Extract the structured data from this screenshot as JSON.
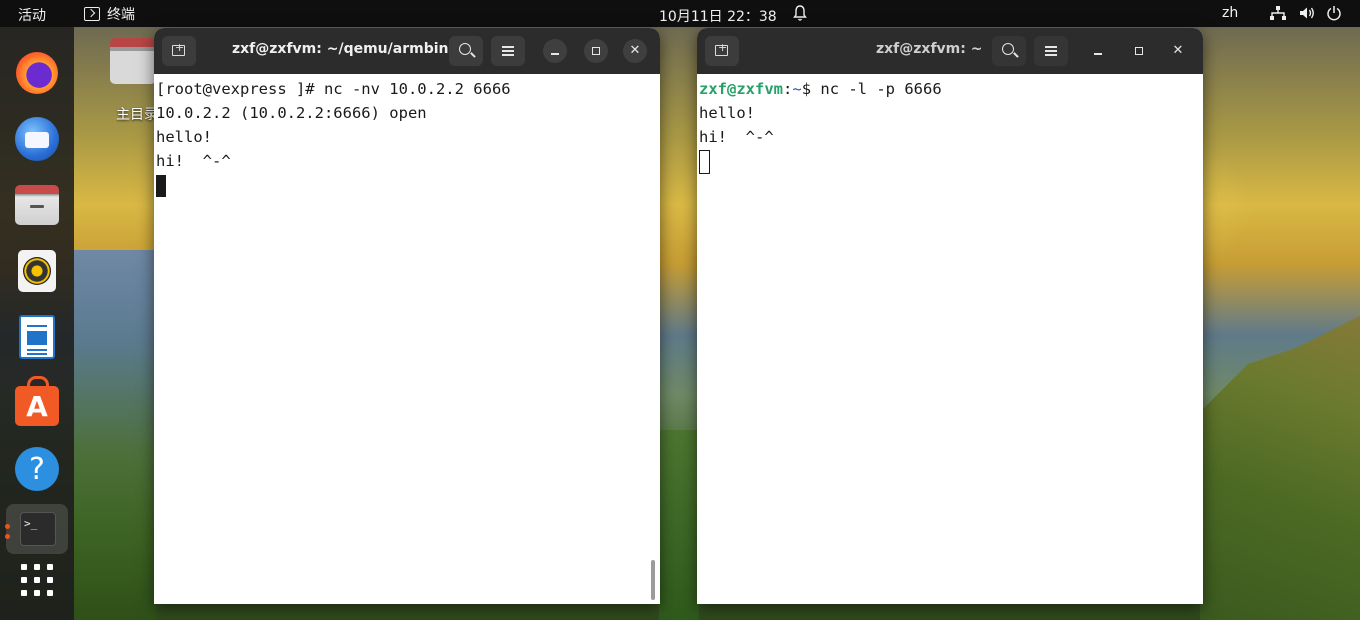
{
  "topbar": {
    "activities": "活动",
    "app_name": "终端",
    "clock": "10月11日  22：38",
    "lang": "zh",
    "icons": [
      "bell-icon",
      "network-icon",
      "volume-icon",
      "power-icon"
    ]
  },
  "dock": {
    "items": [
      "firefox",
      "thunderbird",
      "files",
      "rhythmbox",
      "libreoffice-writer",
      "app-center",
      "help",
      "terminal",
      "show-apps"
    ]
  },
  "desktop": {
    "home_label": "主目录"
  },
  "left_window": {
    "title": "zxf@zxfvm: ~/qemu/armbin",
    "lines": [
      "[root@vexpress ]# nc -nv 10.0.2.2 6666",
      "10.0.2.2 (10.0.2.2:6666) open",
      "hello!",
      "hi!  ^-^"
    ]
  },
  "right_window": {
    "title": "zxf@zxfvm: ~",
    "prompt_user": "zxf@zxfvm",
    "prompt_sep": ":",
    "prompt_path": "~",
    "prompt_symbol": "$ ",
    "command": "nc -l -p 6666",
    "lines": [
      "hello!",
      "hi!  ^-^"
    ]
  },
  "colors": {
    "accent": "#e95420",
    "prompt_user": "#26a269",
    "prompt_path": "#1c5fb8",
    "titlebar": "#2c2c2c"
  }
}
